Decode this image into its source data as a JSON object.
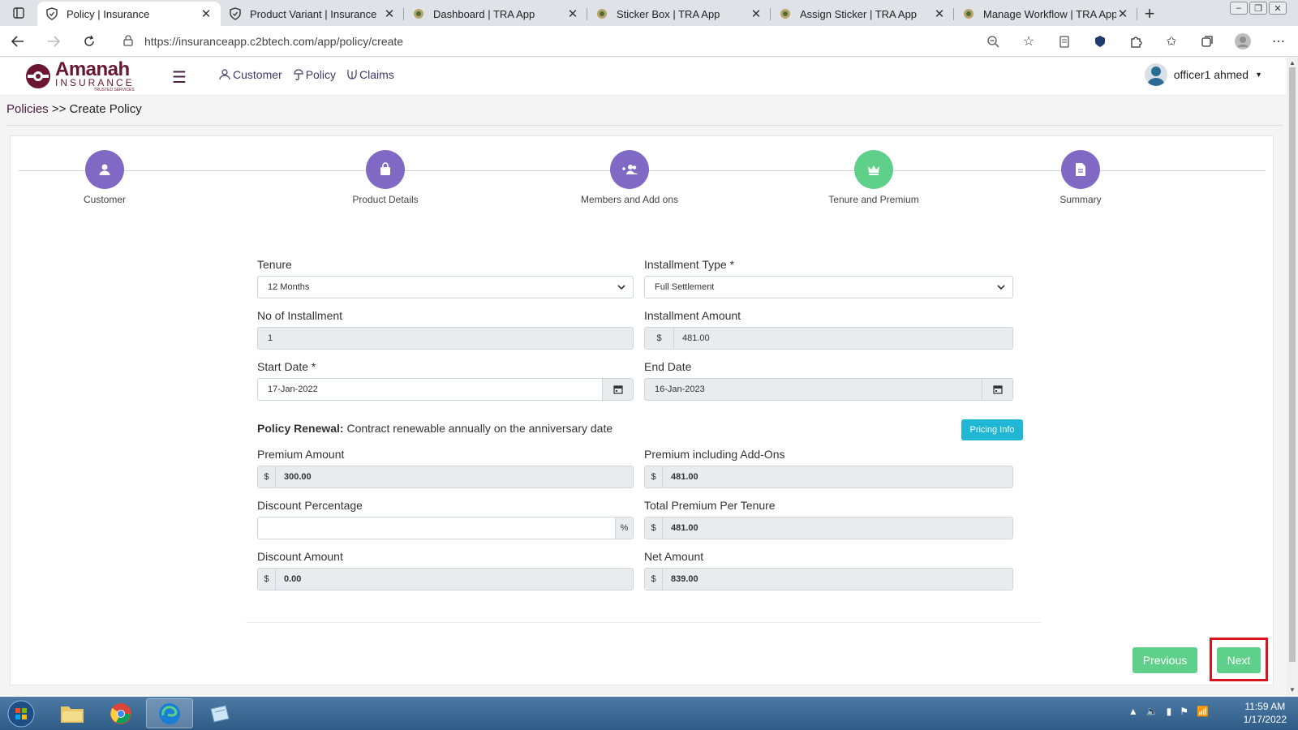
{
  "browser": {
    "tabs": [
      {
        "title": "Policy | Insurance",
        "active": true,
        "icon": "shield-icon"
      },
      {
        "title": "Product Variant | Insurance",
        "active": false,
        "icon": "shield-icon"
      },
      {
        "title": "Dashboard | TRA App",
        "active": false,
        "icon": "crest-icon"
      },
      {
        "title": "Sticker Box | TRA App",
        "active": false,
        "icon": "crest-icon"
      },
      {
        "title": "Assign Sticker | TRA App",
        "active": false,
        "icon": "crest-icon"
      },
      {
        "title": "Manage Workflow | TRA App",
        "active": false,
        "icon": "crest-icon"
      }
    ],
    "url": "https://insuranceapp.c2btech.com/app/policy/create"
  },
  "app": {
    "logo": {
      "name": "Amanah",
      "sub": "INSURANCE",
      "tag": "TRUSTED SERVICES"
    },
    "nav": {
      "customer": "Customer",
      "policy": "Policy",
      "claims": "Claims"
    },
    "user": "officer1 ahmed",
    "breadcrumb": {
      "root": "Policies",
      "sep": " >> ",
      "current": "Create Policy"
    }
  },
  "steps": [
    {
      "label": "Customer",
      "icon": "person-icon",
      "color": "#8069c4"
    },
    {
      "label": "Product Details",
      "icon": "bag-icon",
      "color": "#8069c4"
    },
    {
      "label": "Members and Add ons",
      "icon": "add-users-icon",
      "color": "#8069c4"
    },
    {
      "label": "Tenure and Premium",
      "icon": "crown-icon",
      "color": "#5fd08a"
    },
    {
      "label": "Summary",
      "icon": "document-icon",
      "color": "#8069c4"
    }
  ],
  "form": {
    "tenure": {
      "label": "Tenure",
      "value": "12 Months"
    },
    "installment_type": {
      "label": "Installment Type *",
      "value": "Full Settlement"
    },
    "no_of_installment": {
      "label": "No of Installment",
      "value": "1"
    },
    "installment_amount": {
      "label": "Installment Amount",
      "prefix": "$",
      "value": "481.00"
    },
    "start_date": {
      "label": "Start Date *",
      "value": "17-Jan-2022"
    },
    "end_date": {
      "label": "End Date",
      "value": "16-Jan-2023"
    },
    "renewal": {
      "label": "Policy Renewal:",
      "text": " Contract renewable annually on the anniversary date"
    },
    "pricing_info": "Pricing Info",
    "premium_amount": {
      "label": "Premium Amount",
      "prefix": "$",
      "value": "300.00"
    },
    "premium_addons": {
      "label": "Premium including Add-Ons",
      "prefix": "$",
      "value": "481.00"
    },
    "discount_percentage": {
      "label": "Discount Percentage",
      "value": "",
      "suffix": "%"
    },
    "total_premium": {
      "label": "Total Premium Per Tenure",
      "prefix": "$",
      "value": "481.00"
    },
    "discount_amount": {
      "label": "Discount Amount",
      "prefix": "$",
      "value": "0.00"
    },
    "net_amount": {
      "label": "Net Amount",
      "prefix": "$",
      "value": "839.00"
    }
  },
  "buttons": {
    "previous": "Previous",
    "next": "Next"
  },
  "taskbar": {
    "time": "11:59 AM",
    "date": "1/17/2022"
  },
  "colors": {
    "primary": "#8069c4",
    "success": "#5fd08a",
    "info": "#1fb7d4",
    "highlight": "#d9141e",
    "brand": "#6b1631"
  }
}
